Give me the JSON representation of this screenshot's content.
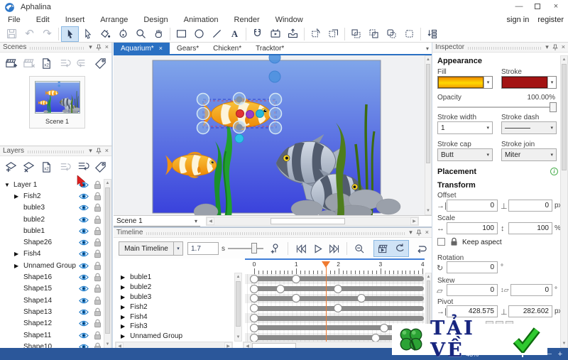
{
  "app": {
    "title": "Aphalina"
  },
  "account": {
    "sign_in": "sign in",
    "register": "register"
  },
  "menu": {
    "items": [
      "File",
      "Edit",
      "Insert",
      "Arrange",
      "Design",
      "Animation",
      "Render",
      "Window"
    ]
  },
  "scenes": {
    "title": "Scenes",
    "scene_name": "Scene 1"
  },
  "layers": {
    "title": "Layers",
    "rows": [
      {
        "name": "Layer 1",
        "indent": 0,
        "arrow": "expanded"
      },
      {
        "name": "Fish2",
        "indent": 1,
        "arrow": "collapsed"
      },
      {
        "name": "buble3",
        "indent": 1,
        "arrow": "none"
      },
      {
        "name": "buble2",
        "indent": 1,
        "arrow": "none"
      },
      {
        "name": "buble1",
        "indent": 1,
        "arrow": "none"
      },
      {
        "name": "Shape26",
        "indent": 1,
        "arrow": "none"
      },
      {
        "name": "Fish4",
        "indent": 1,
        "arrow": "collapsed"
      },
      {
        "name": "Unnamed Group",
        "indent": 1,
        "arrow": "collapsed"
      },
      {
        "name": "Shape16",
        "indent": 1,
        "arrow": "none"
      },
      {
        "name": "Shape15",
        "indent": 1,
        "arrow": "none"
      },
      {
        "name": "Shape14",
        "indent": 1,
        "arrow": "none"
      },
      {
        "name": "Shape13",
        "indent": 1,
        "arrow": "none"
      },
      {
        "name": "Shape12",
        "indent": 1,
        "arrow": "none"
      },
      {
        "name": "Shape11",
        "indent": 1,
        "arrow": "none"
      },
      {
        "name": "Shape10",
        "indent": 1,
        "arrow": "none"
      }
    ]
  },
  "tabs": {
    "items": [
      {
        "label": "Aquarium*"
      },
      {
        "label": "Gears*"
      },
      {
        "label": "Chicken*"
      },
      {
        "label": "Tracktor*"
      }
    ],
    "active_index": 0
  },
  "scene_bar": {
    "selected": "Scene 1"
  },
  "timeline": {
    "title": "Timeline",
    "selector_value": "Main Timeline",
    "time_value": "1.7",
    "time_unit": "s",
    "playhead": 1.7,
    "ruler_labels": [
      0,
      1,
      2,
      3,
      4
    ],
    "tracks": [
      {
        "name": "buble1",
        "keyframes": [
          0,
          1.0
        ]
      },
      {
        "name": "buble2",
        "keyframes": [
          0,
          0.63,
          2.0
        ]
      },
      {
        "name": "buble3",
        "keyframes": [
          0,
          1.0,
          2.55
        ]
      },
      {
        "name": "Fish2",
        "keyframes": [
          0,
          2.0
        ]
      },
      {
        "name": "Fish4",
        "keyframes": [
          0
        ]
      },
      {
        "name": "Fish3",
        "keyframes": [
          0,
          3.1
        ]
      },
      {
        "name": "Unnamed Group",
        "keyframes": [
          0,
          2.9
        ]
      }
    ]
  },
  "inspector": {
    "title": "Inspector",
    "appearance_heading": "Appearance",
    "fill_label": "Fill",
    "stroke_label": "Stroke",
    "opacity_label": "Opacity",
    "opacity_value": "100.00%",
    "stroke_width_label": "Stroke width",
    "stroke_width_value": "1",
    "stroke_dash_label": "Stroke dash",
    "stroke_cap_label": "Stroke cap",
    "stroke_cap_value": "Butt",
    "stroke_join_label": "Stroke join",
    "stroke_join_value": "Miter",
    "placement_heading": "Placement",
    "transform_heading": "Transform",
    "offset_label": "Offset",
    "offset_x": "0",
    "offset_y": "0",
    "offset_unit": "px",
    "scale_label": "Scale",
    "scale_x": "100",
    "scale_y": "100",
    "scale_unit": "%",
    "keep_aspect_label": "Keep aspect",
    "rotation_label": "Rotation",
    "rotation_value": "0",
    "rotation_unit": "°",
    "skew_label": "Skew",
    "skew_x": "0",
    "skew_y": "0",
    "skew_unit": "°",
    "pivot_label": "Pivot",
    "pivot_x": "428.575",
    "pivot_y": "282.602",
    "pivot_unit": "px"
  },
  "statusbar": {
    "zoom_value": "48%"
  },
  "watermark": {
    "text": "TẢI VỀ"
  },
  "colors": {
    "accent": "#2a70c2",
    "statusbar": "#2b579a",
    "playhead": "#f07a30",
    "fill_swatch_top": "#ef8c00",
    "fill_swatch_mid": "#ffd900",
    "stroke_swatch": "#a31313",
    "eye_icon": "#1d7ac8"
  }
}
